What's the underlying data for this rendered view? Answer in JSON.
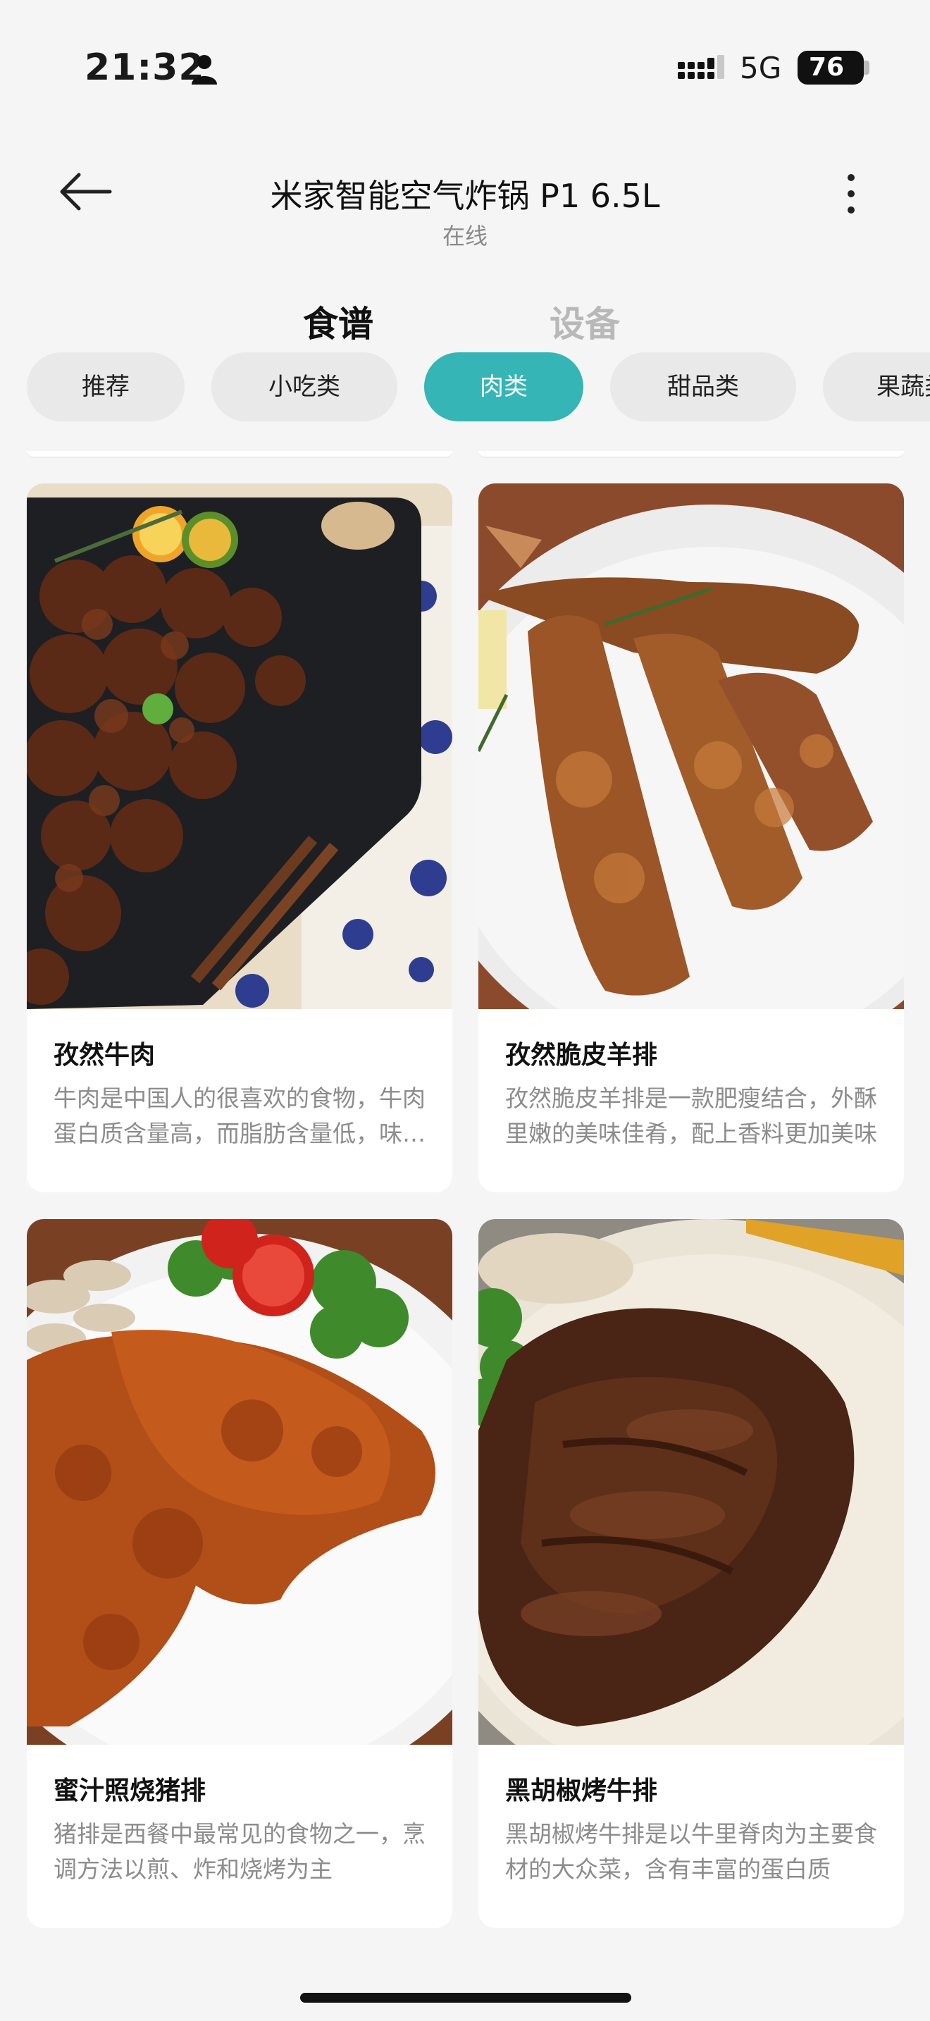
{
  "status_bar": {
    "time": "21:32",
    "network": "5G",
    "battery": "76"
  },
  "header": {
    "title": "米家智能空气炸锅 P1 6.5L",
    "subtitle": "在线"
  },
  "main_tabs": {
    "recipes": "食谱",
    "devices": "设备"
  },
  "categories": [
    "推荐",
    "小吃类",
    "肉类",
    "甜品类",
    "果蔬类"
  ],
  "active_category": "肉类",
  "recipes": [
    {
      "name": "孜然牛肉",
      "desc": "牛肉是中国人的很喜欢的食物，牛肉蛋白质含量高，而脂肪含量低，味道鲜美"
    },
    {
      "name": "孜然脆皮羊排",
      "desc": "孜然脆皮羊排是一款肥瘦结合，外酥里嫩的美味佳肴，配上香料更加美味"
    },
    {
      "name": "蜜汁照烧猪排",
      "desc": "猪排是西餐中最常见的食物之一，烹调方法以煎、炸和烧烤为主"
    },
    {
      "name": "黑胡椒烤牛排",
      "desc": "黑胡椒烤牛排是以牛里脊肉为主要食材的大众菜，含有丰富的蛋白质"
    }
  ],
  "colors": {
    "accent": "#35b5b5",
    "background": "#f5f5f5"
  }
}
